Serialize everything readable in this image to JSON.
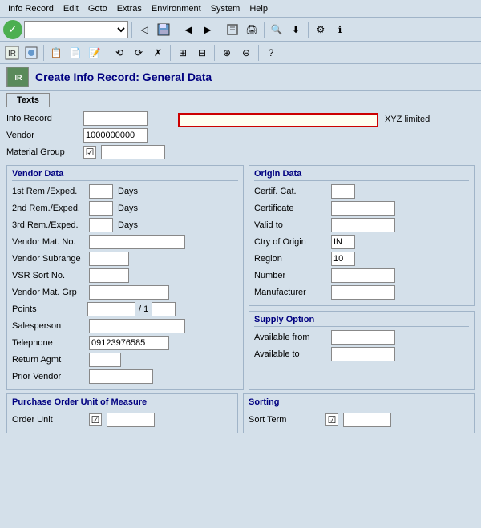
{
  "menubar": {
    "items": [
      {
        "label": "Info Record"
      },
      {
        "label": "Edit"
      },
      {
        "label": "Goto"
      },
      {
        "label": "Extras"
      },
      {
        "label": "Environment"
      },
      {
        "label": "System"
      },
      {
        "label": "Help"
      }
    ]
  },
  "toolbar": {
    "dropdown_value": ""
  },
  "page": {
    "title": "Create Info Record: General Data",
    "icon_text": "IR"
  },
  "tabs": [
    {
      "label": "Texts"
    }
  ],
  "form": {
    "info_record_label": "Info Record",
    "info_record_value": "",
    "info_record_required_value": "",
    "vendor_label": "Vendor",
    "vendor_value": "1000000000",
    "vendor_name": "XYZ limited",
    "material_group_label": "Material Group",
    "material_group_checked": true
  },
  "vendor_data": {
    "title": "Vendor Data",
    "rem1_label": "1st Rem./Exped.",
    "rem1_value": "",
    "rem1_unit": "Days",
    "rem2_label": "2nd Rem./Exped.",
    "rem2_value": "",
    "rem2_unit": "Days",
    "rem3_label": "3rd Rem./Exped.",
    "rem3_value": "",
    "rem3_unit": "Days",
    "vendor_mat_no_label": "Vendor Mat. No.",
    "vendor_mat_no_value": "",
    "vendor_subrange_label": "Vendor Subrange",
    "vendor_subrange_value": "",
    "vsr_sort_label": "VSR Sort No.",
    "vsr_sort_value": "",
    "vendor_mat_grp_label": "Vendor Mat. Grp",
    "vendor_mat_grp_value": "",
    "points_label": "Points",
    "points_value": "",
    "points_divider": "/ 1",
    "salesperson_label": "Salesperson",
    "salesperson_value": "",
    "telephone_label": "Telephone",
    "telephone_value": "09123976585",
    "return_agmt_label": "Return Agmt",
    "return_agmt_value": "",
    "prior_vendor_label": "Prior Vendor",
    "prior_vendor_value": ""
  },
  "origin_data": {
    "title": "Origin Data",
    "certif_cat_label": "Certif. Cat.",
    "certif_cat_value": "",
    "certificate_label": "Certificate",
    "certificate_value": "",
    "valid_to_label": "Valid to",
    "valid_to_value": "",
    "ctry_origin_label": "Ctry of Origin",
    "ctry_origin_value": "IN",
    "region_label": "Region",
    "region_value": "10",
    "number_label": "Number",
    "number_value": "",
    "manufacturer_label": "Manufacturer",
    "manufacturer_value": ""
  },
  "supply_option": {
    "title": "Supply Option",
    "available_from_label": "Available from",
    "available_from_value": "",
    "available_to_label": "Available to",
    "available_to_value": ""
  },
  "purchase_order": {
    "title": "Purchase Order Unit of Measure",
    "order_unit_label": "Order Unit",
    "order_unit_checked": true
  },
  "sorting": {
    "title": "Sorting",
    "sort_term_label": "Sort Term",
    "sort_term_checked": true
  }
}
